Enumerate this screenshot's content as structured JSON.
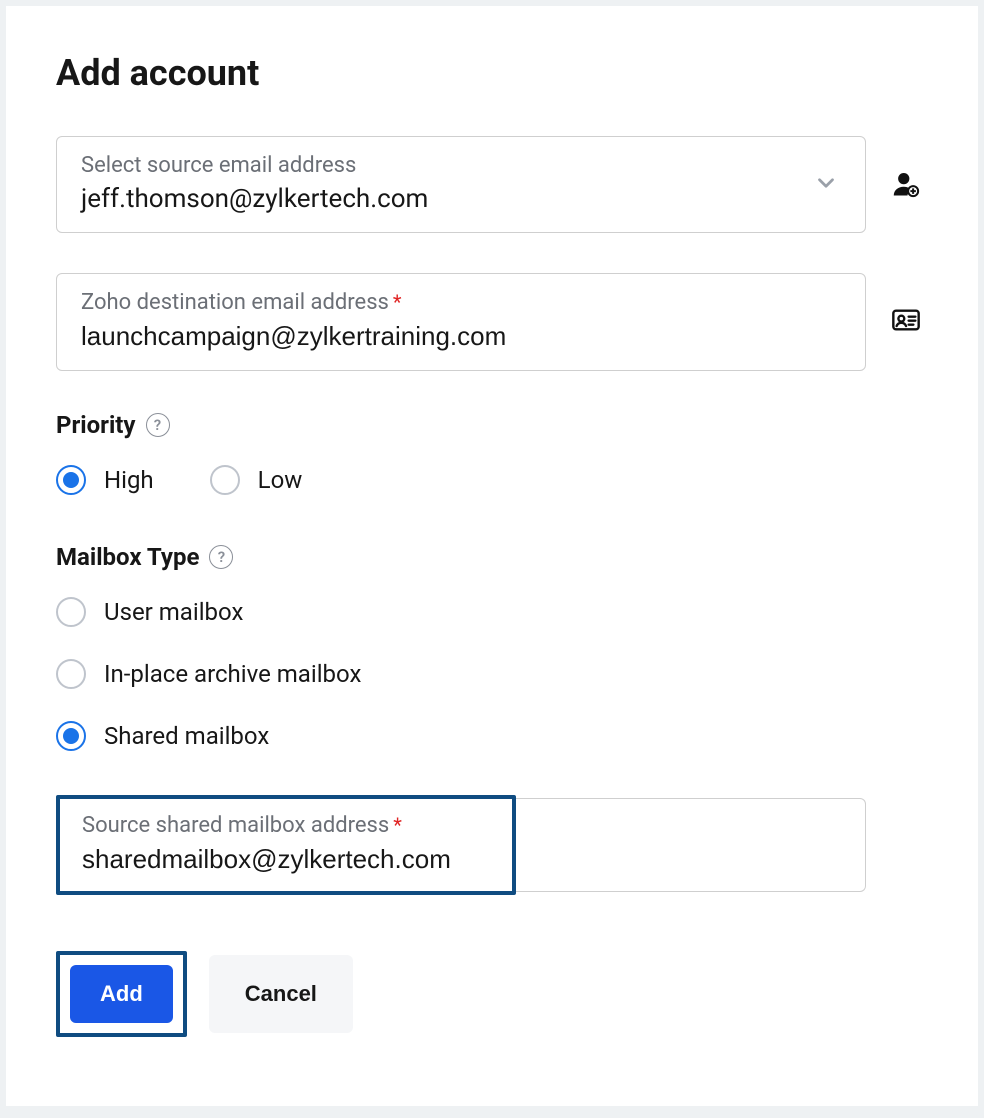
{
  "title": "Add account",
  "source": {
    "label": "Select source email address",
    "value": "jeff.thomson@zylkertech.com"
  },
  "destination": {
    "label": "Zoho destination email address",
    "required": true,
    "value": "launchcampaign@zylkertraining.com"
  },
  "priority": {
    "label": "Priority",
    "options": [
      {
        "label": "High",
        "selected": true
      },
      {
        "label": "Low",
        "selected": false
      }
    ]
  },
  "mailbox_type": {
    "label": "Mailbox Type",
    "options": [
      {
        "label": "User mailbox",
        "selected": false
      },
      {
        "label": "In-place archive mailbox",
        "selected": false
      },
      {
        "label": "Shared mailbox",
        "selected": true
      }
    ]
  },
  "shared_source": {
    "label": "Source shared mailbox address",
    "required": true,
    "value": "sharedmailbox@zylkertech.com"
  },
  "buttons": {
    "add": "Add",
    "cancel": "Cancel"
  }
}
